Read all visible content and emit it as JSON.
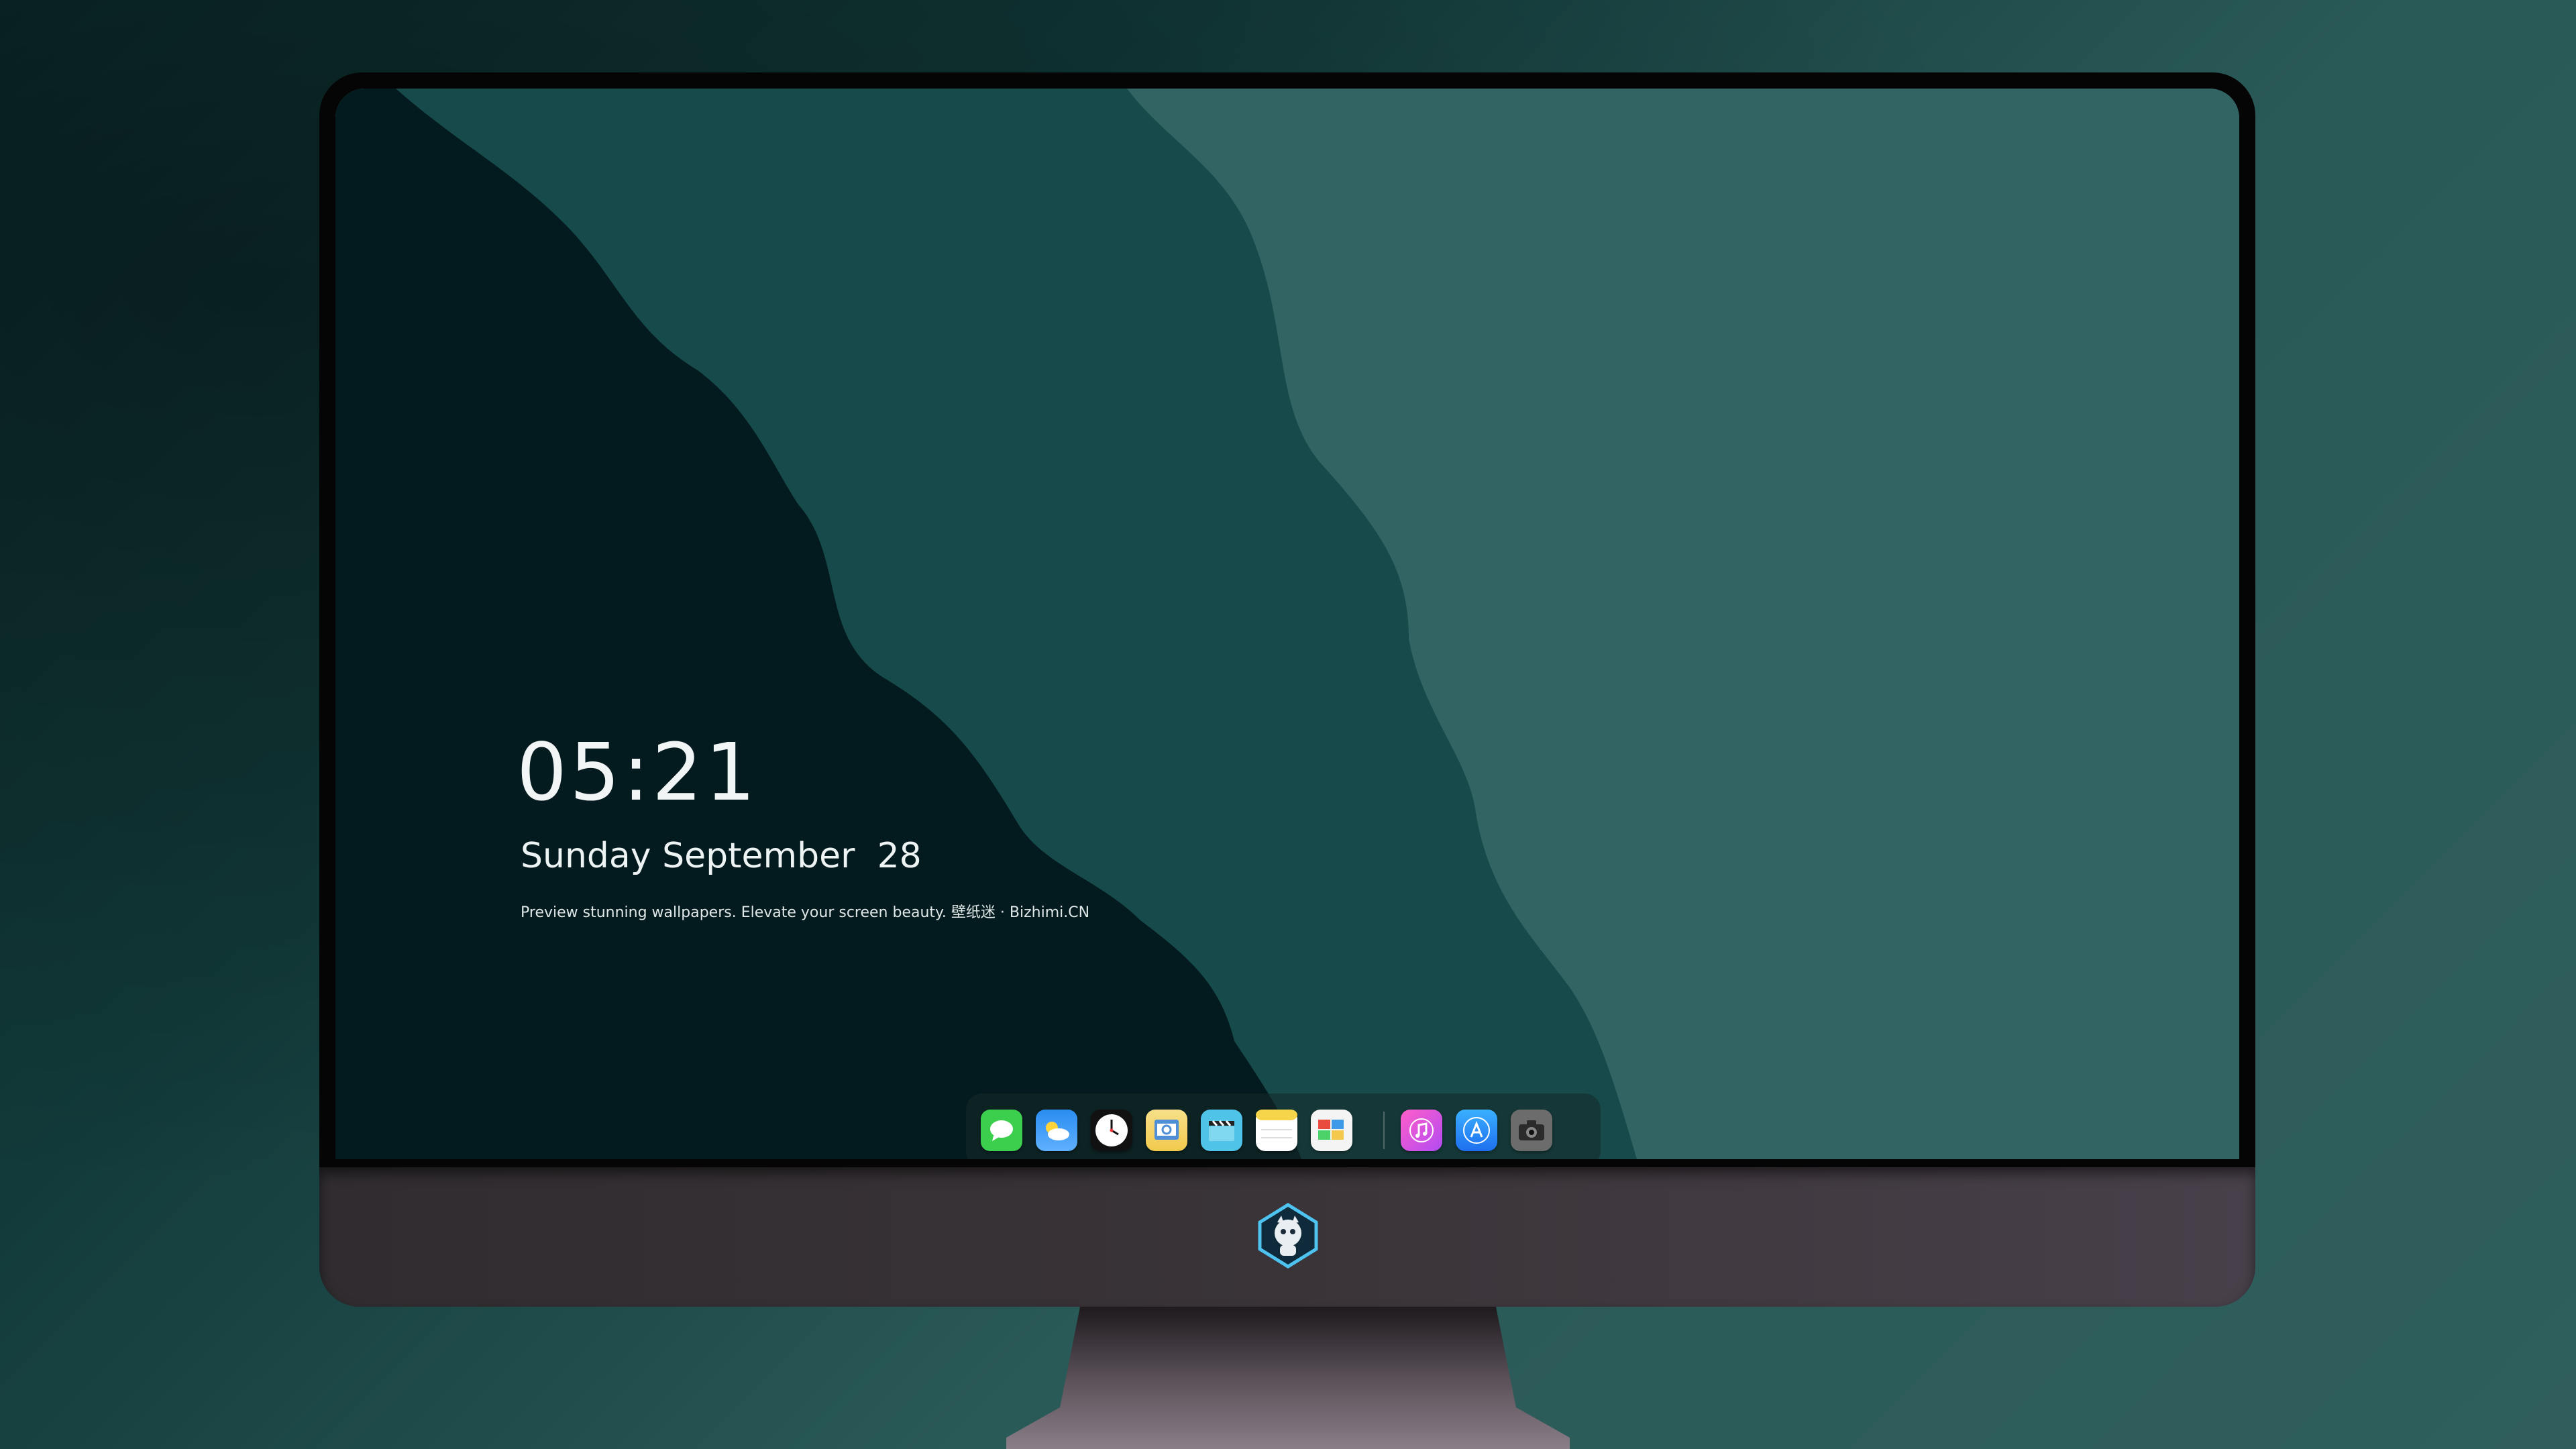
{
  "lock_screen": {
    "time": "05:21",
    "date": "Sunday September  28",
    "tagline": "Preview stunning wallpapers. Elevate your screen beauty. 壁纸迷 · Bizhimi.CN"
  },
  "dock": {
    "apps": [
      {
        "name": "messages-icon",
        "color": "#3ccf4e"
      },
      {
        "name": "weather-icon",
        "color": "#2a8cf0"
      },
      {
        "name": "clock-icon",
        "color": "#111111"
      },
      {
        "name": "preview-icon",
        "color": "#f2c94c"
      },
      {
        "name": "clips-icon",
        "color": "#4fc3e8"
      },
      {
        "name": "notes-icon",
        "color": "#f7d54a"
      },
      {
        "name": "photo-editor-icon",
        "color": "#f4f4f4"
      },
      {
        "name": "music-icon",
        "color": "#d84de0"
      },
      {
        "name": "app-store-icon",
        "color": "#1e8ef5"
      },
      {
        "name": "camera-icon",
        "color": "#6c6c6c"
      }
    ]
  },
  "colors": {
    "wall_dark": "#031b1e",
    "wall_mid": "#174a4a",
    "wall_light": "#336464",
    "chin": "#3a3438"
  }
}
